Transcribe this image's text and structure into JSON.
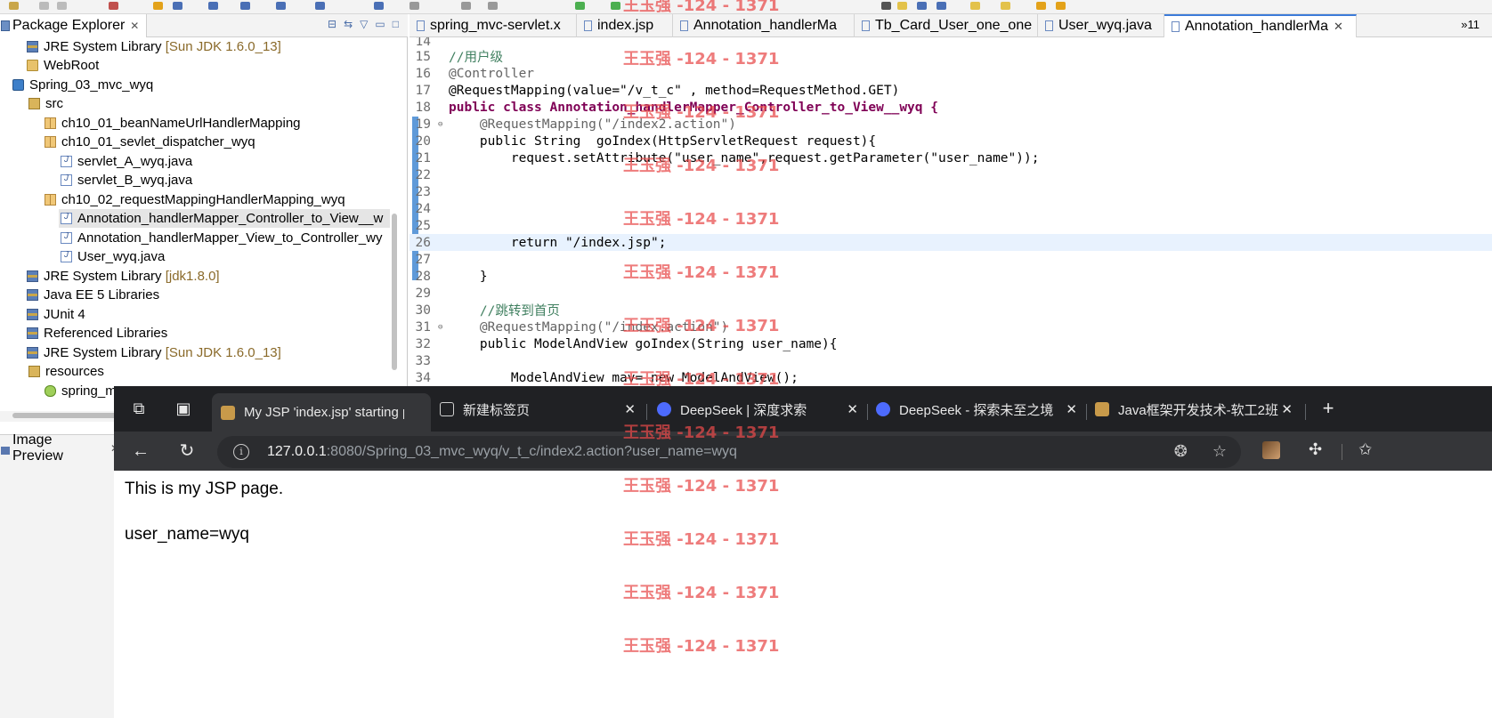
{
  "package_explorer": {
    "title": "Package Explorer",
    "tree": [
      {
        "label": "JRE System Library",
        "decor": "[Sun JDK 1.6.0_13]",
        "icon": "library-icon",
        "indent": 1
      },
      {
        "label": "WebRoot",
        "decor": "",
        "icon": "folder-icon",
        "indent": 1
      },
      {
        "label": "Spring_03_mvc_wyq",
        "decor": "",
        "icon": "project-icon",
        "indent": 0
      },
      {
        "label": "src",
        "decor": "",
        "icon": "source-folder-icon",
        "indent": 1
      },
      {
        "label": "ch10_01_beanNameUrlHandlerMapping",
        "decor": "",
        "icon": "package-icon",
        "indent": 2
      },
      {
        "label": "ch10_01_sevlet_dispatcher_wyq",
        "decor": "",
        "icon": "package-icon",
        "indent": 2
      },
      {
        "label": "servlet_A_wyq.java",
        "decor": "",
        "icon": "java-file-icon",
        "indent": 3
      },
      {
        "label": "servlet_B_wyq.java",
        "decor": "",
        "icon": "java-file-icon",
        "indent": 3
      },
      {
        "label": "ch10_02_requestMappingHandlerMapping_wyq",
        "decor": "",
        "icon": "package-icon",
        "indent": 2
      },
      {
        "label": "Annotation_handlerMapper_Controller_to_View__w",
        "decor": "",
        "icon": "java-file-icon",
        "indent": 3,
        "selected": true
      },
      {
        "label": "Annotation_handlerMapper_View_to_Controller_wy",
        "decor": "",
        "icon": "java-file-icon",
        "indent": 3
      },
      {
        "label": "User_wyq.java",
        "decor": "",
        "icon": "java-file-icon",
        "indent": 3
      },
      {
        "label": "JRE System Library",
        "decor": "[jdk1.8.0]",
        "icon": "library-icon",
        "indent": 1
      },
      {
        "label": "Java EE 5 Libraries",
        "decor": "",
        "icon": "library-icon",
        "indent": 1
      },
      {
        "label": "JUnit 4",
        "decor": "",
        "icon": "library-icon",
        "indent": 1
      },
      {
        "label": "Referenced Libraries",
        "decor": "",
        "icon": "library-icon",
        "indent": 1
      },
      {
        "label": "JRE System Library",
        "decor": "[Sun JDK 1.6.0_13]",
        "icon": "library-icon",
        "indent": 1
      },
      {
        "label": "resources",
        "decor": "",
        "icon": "source-folder-icon",
        "indent": 1
      },
      {
        "label": "spring_m",
        "decor": "",
        "icon": "xml-file-icon",
        "indent": 2
      }
    ]
  },
  "image_preview": {
    "title": "Image Preview"
  },
  "editor": {
    "tabs": [
      {
        "label": "spring_mvc-servlet.x",
        "icon": "xml-file-icon",
        "active": false
      },
      {
        "label": "index.jsp",
        "icon": "jsp-file-icon",
        "active": false
      },
      {
        "label": "Annotation_handlerMa",
        "icon": "java-file-icon",
        "active": false
      },
      {
        "label": "Tb_Card_User_one_one",
        "icon": "java-file-icon",
        "active": false
      },
      {
        "label": "User_wyq.java",
        "icon": "java-file-icon",
        "active": false
      },
      {
        "label": "Annotation_handlerMa",
        "icon": "java-file-icon",
        "active": true
      }
    ],
    "overflow_label": "»11",
    "lines": [
      {
        "n": "14",
        "code": ""
      },
      {
        "n": "15",
        "code": "//用户级"
      },
      {
        "n": "16",
        "code": "@Controller"
      },
      {
        "n": "17",
        "code": "@RequestMapping(value=\"/v_t_c\" , method=RequestMethod.GET)"
      },
      {
        "n": "18",
        "code": "public class Annotation_handlerMapper_Controller_to_View__wyq {"
      },
      {
        "n": "19",
        "code": "    @RequestMapping(\"/index2.action\")"
      },
      {
        "n": "20",
        "code": "    public String  goIndex(HttpServletRequest request){"
      },
      {
        "n": "21",
        "code": "        request.setAttribute(\"user_name\",request.getParameter(\"user_name\"));"
      },
      {
        "n": "22",
        "code": ""
      },
      {
        "n": "23",
        "code": ""
      },
      {
        "n": "24",
        "code": ""
      },
      {
        "n": "25",
        "code": ""
      },
      {
        "n": "26",
        "code": "        return \"/index.jsp\";"
      },
      {
        "n": "27",
        "code": ""
      },
      {
        "n": "28",
        "code": "    }"
      },
      {
        "n": "29",
        "code": ""
      },
      {
        "n": "30",
        "code": "    //跳转到首页"
      },
      {
        "n": "31",
        "code": "    @RequestMapping(\"/index.action\")"
      },
      {
        "n": "32",
        "code": "    public ModelAndView goIndex(String user_name){"
      },
      {
        "n": "33",
        "code": ""
      },
      {
        "n": "34",
        "code": "        ModelAndView mav= new ModelAndView();"
      }
    ]
  },
  "browser": {
    "tabs": [
      {
        "label": "My JSP 'index.jsp' starting p",
        "icon": "jsp-page-favicon",
        "active": true
      },
      {
        "label": "新建标签页",
        "icon": "new-tab-favicon",
        "active": false
      },
      {
        "label": "DeepSeek | 深度求索",
        "icon": "deepseek-favicon",
        "active": false
      },
      {
        "label": "DeepSeek - 探索未至之境",
        "icon": "deepseek-favicon",
        "active": false
      },
      {
        "label": "Java框架开发技术-软工2班-",
        "icon": "course-favicon",
        "active": false
      }
    ],
    "url_host": "127.0.0.1",
    "url_rest": ":8080/Spring_03_mvc_wyq/v_t_c/index2.action?user_name=wyq",
    "page": {
      "heading": "This is my JSP page.",
      "line": "user_name=wyq"
    }
  },
  "watermark": {
    "text": "王玉强 -124 - 1371",
    "color": "#e84a4a"
  }
}
